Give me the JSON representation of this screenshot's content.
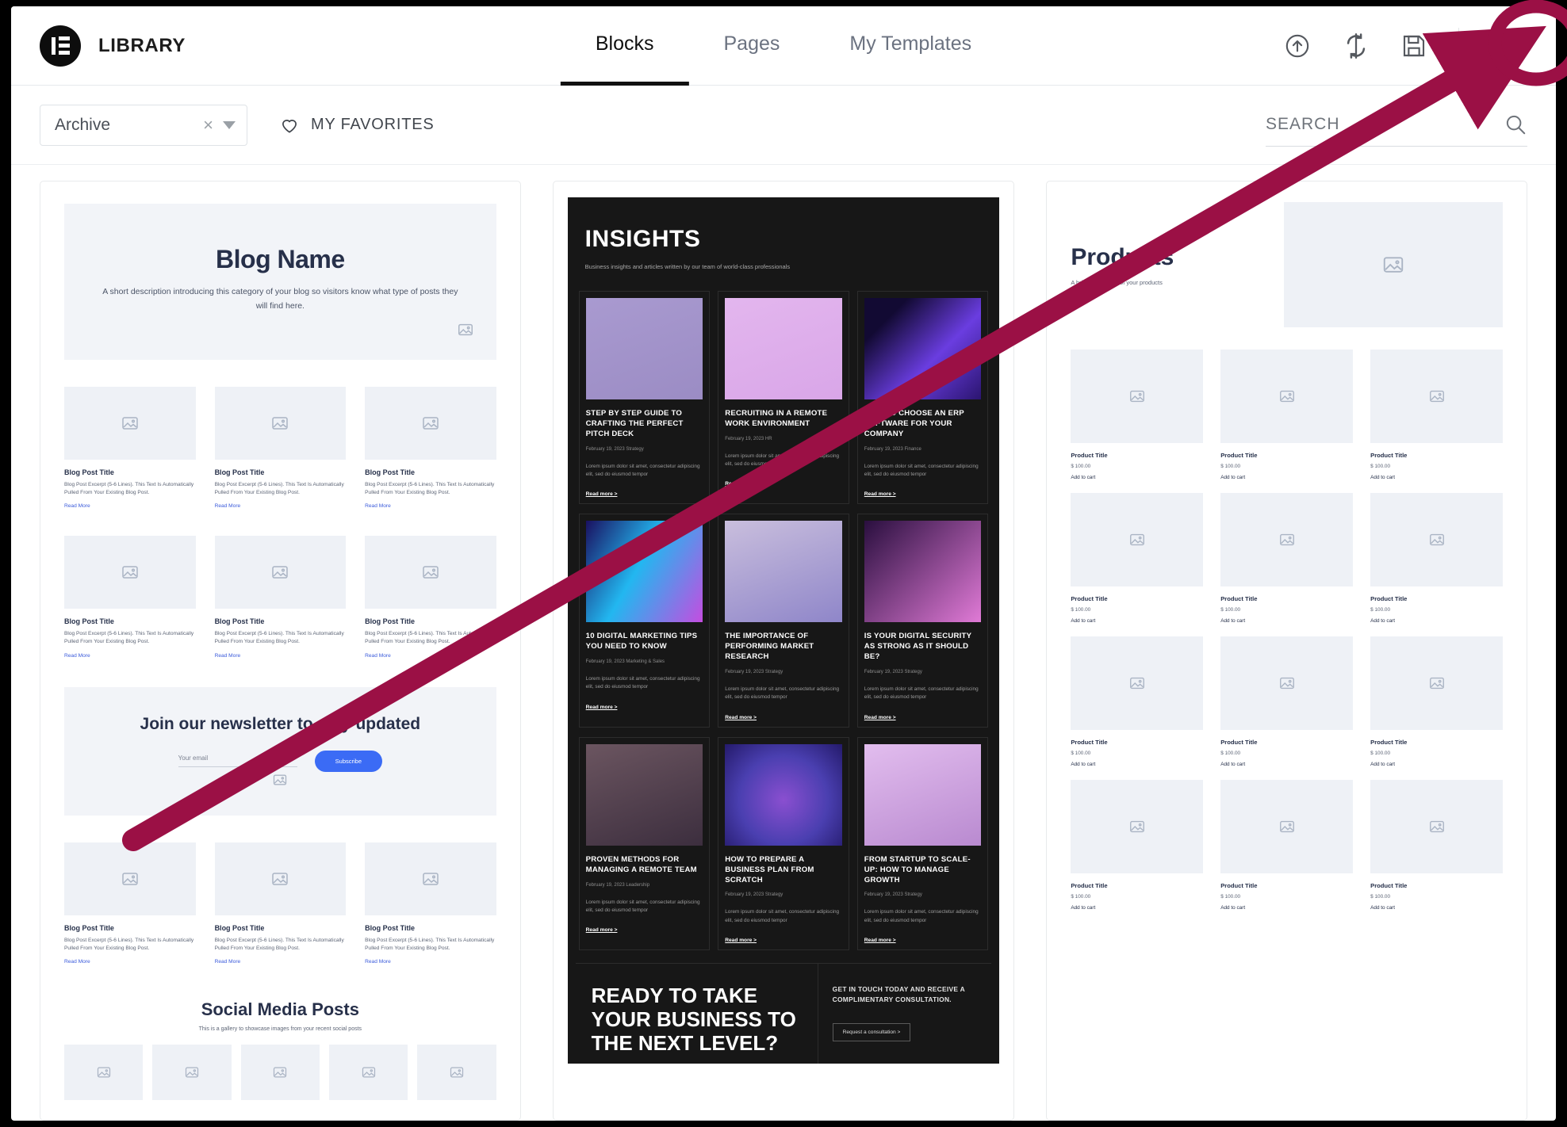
{
  "header": {
    "brand_title": "LIBRARY",
    "logo_icon": "elementor-logo-icon",
    "tabs": [
      {
        "label": "Blocks",
        "active": true
      },
      {
        "label": "Pages",
        "active": false
      },
      {
        "label": "My Templates",
        "active": false
      }
    ],
    "actions": [
      {
        "name": "upload-icon",
        "title": "Import Template"
      },
      {
        "name": "sync-icon",
        "title": "Sync Library"
      },
      {
        "name": "save-icon",
        "title": "Save"
      },
      {
        "name": "close-icon",
        "title": "Close"
      }
    ]
  },
  "filterbar": {
    "category_value": "Archive",
    "clear_glyph": "×",
    "favorites_label": "MY FAVORITES",
    "favorites_icon": "heart-icon",
    "search_placeholder": "SEARCH",
    "search_value": "",
    "search_icon": "search-icon"
  },
  "cards": {
    "blog": {
      "hero_title": "Blog Name",
      "hero_desc": "A short description introducing this category of your blog so visitors know what type of posts they will find here.",
      "post_title": "Blog Post Title",
      "post_excerpt": "Blog Post Excerpt (5-6 Lines). This Text Is Automatically Pulled From Your Existing Blog Post.",
      "read_more": "Read More",
      "newsletter_title": "Join our newsletter to stay updated",
      "newsletter_field": "Your email",
      "newsletter_button": "Subscribe",
      "social_title": "Social Media Posts",
      "social_desc": "This is a gallery to showcase images from your recent social posts",
      "image_placeholder_icon": "image-placeholder-icon"
    },
    "insights": {
      "title": "INSIGHTS",
      "subtitle": "Business insights and articles written by our team of world-class professionals",
      "excerpt": "Lorem ipsum dolor sit amet, consectetur adipiscing elit, sed do eiusmod tempor",
      "read_more": "Read more >",
      "articles": [
        {
          "title": "STEP BY STEP GUIDE TO CRAFTING THE PERFECT PITCH DECK",
          "meta": "February 19, 2023  Strategy",
          "image": "open-book-photo",
          "c1": "#9b8cc4",
          "c2": "#a99ad0"
        },
        {
          "title": "RECRUITING IN A REMOTE WORK ENVIRONMENT",
          "meta": "February 19, 2023  HR",
          "image": "glass-vials-photo",
          "c1": "#d9a6e8",
          "c2": "#e3b6ee"
        },
        {
          "title": "HOW TO CHOOSE AN ERP SOFTWARE FOR YOUR COMPANY",
          "meta": "February 19, 2023  Finance",
          "image": "neon-corridor-photo",
          "c1": "#120a33",
          "c2": "#6a3de0"
        },
        {
          "title": "10 DIGITAL MARKETING TIPS YOU NEED TO KNOW",
          "meta": "February 19, 2023  Marketing & Sales",
          "image": "neon-keyboard-photo",
          "c1": "#1a1060",
          "c2": "#22b7f0"
        },
        {
          "title": "THE IMPORTANCE OF PERFORMING MARKET RESEARCH",
          "meta": "February 19, 2023  Strategy",
          "image": "woman-portrait-photo",
          "c1": "#8f86c9",
          "c2": "#c9bedd"
        },
        {
          "title": "IS YOUR DIGITAL SECURITY AS STRONG AS IT SHOULD BE?",
          "meta": "February 19, 2023  Strategy",
          "image": "pink-grid-photo",
          "c1": "#2a0f3f",
          "c2": "#e07ad6"
        },
        {
          "title": "PROVEN METHODS FOR MANAGING A REMOTE TEAM",
          "meta": "February 19, 2023  Leadership",
          "image": "interior-room-photo",
          "c1": "#3c2e3e",
          "c2": "#a08090"
        },
        {
          "title": "HOW TO PREPARE A BUSINESS PLAN FROM SCRATCH",
          "meta": "February 19, 2023  Strategy",
          "image": "purple-sphere-photo",
          "c1": "#4a3fb0",
          "c2": "#8a4fd0"
        },
        {
          "title": "FROM STARTUP TO SCALE-UP: HOW TO MANAGE GROWTH",
          "meta": "February 19, 2023  Strategy",
          "image": "pink-cubes-photo",
          "c1": "#d9a8e8",
          "c2": "#b98ad0"
        }
      ],
      "cta_title": "READY TO TAKE YOUR BUSINESS TO THE NEXT LEVEL?",
      "cta_text": "GET IN TOUCH TODAY AND RECEIVE A COMPLIMENTARY CONSULTATION.",
      "cta_button": "Request a consultation >"
    },
    "products": {
      "title": "Products",
      "desc": "A brief description of your products",
      "product_title": "Product Title",
      "product_price": "$ 100.00",
      "add_to_cart": "Add to cart",
      "image_placeholder_icon": "image-placeholder-icon"
    }
  },
  "annotation": {
    "shape": "arrow-and-ellipse-highlight",
    "color": "#9B1045",
    "target": "close-icon"
  }
}
